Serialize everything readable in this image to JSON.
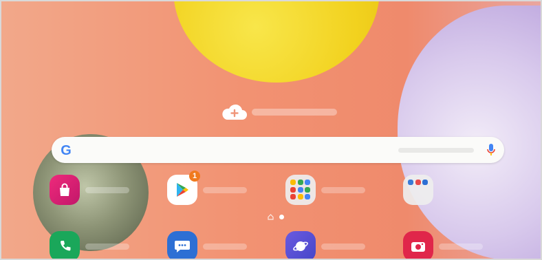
{
  "home_screen": {
    "weather_widget": {
      "icon": "cloud-plus-icon"
    },
    "search_bar": {
      "logo": "G",
      "logo_icon": "google-icon",
      "mic_icon": "microphone-icon"
    },
    "apps": [
      {
        "name": "galaxy-store",
        "icon": "shopping-bag-icon",
        "color": "#d4146e"
      },
      {
        "name": "play-store",
        "icon": "play-triangle-icon",
        "badge": "1",
        "color": "#ffffff"
      },
      {
        "name": "google-folder",
        "icon": "folder-grid-icon",
        "color": "#eeeeee"
      },
      {
        "name": "tools-folder",
        "icon": "folder-grid-icon",
        "color": "#eeeeee"
      }
    ],
    "dock": [
      {
        "name": "phone",
        "icon": "phone-icon",
        "color": "#1aa75a"
      },
      {
        "name": "messages",
        "icon": "message-bubble-icon",
        "color": "#2d6fd4"
      },
      {
        "name": "internet",
        "icon": "planet-icon",
        "color": "#5a5ad6"
      },
      {
        "name": "camera",
        "icon": "camera-icon",
        "color": "#e0264a"
      }
    ],
    "page_indicator": {
      "pages": 2,
      "current": 2
    }
  }
}
